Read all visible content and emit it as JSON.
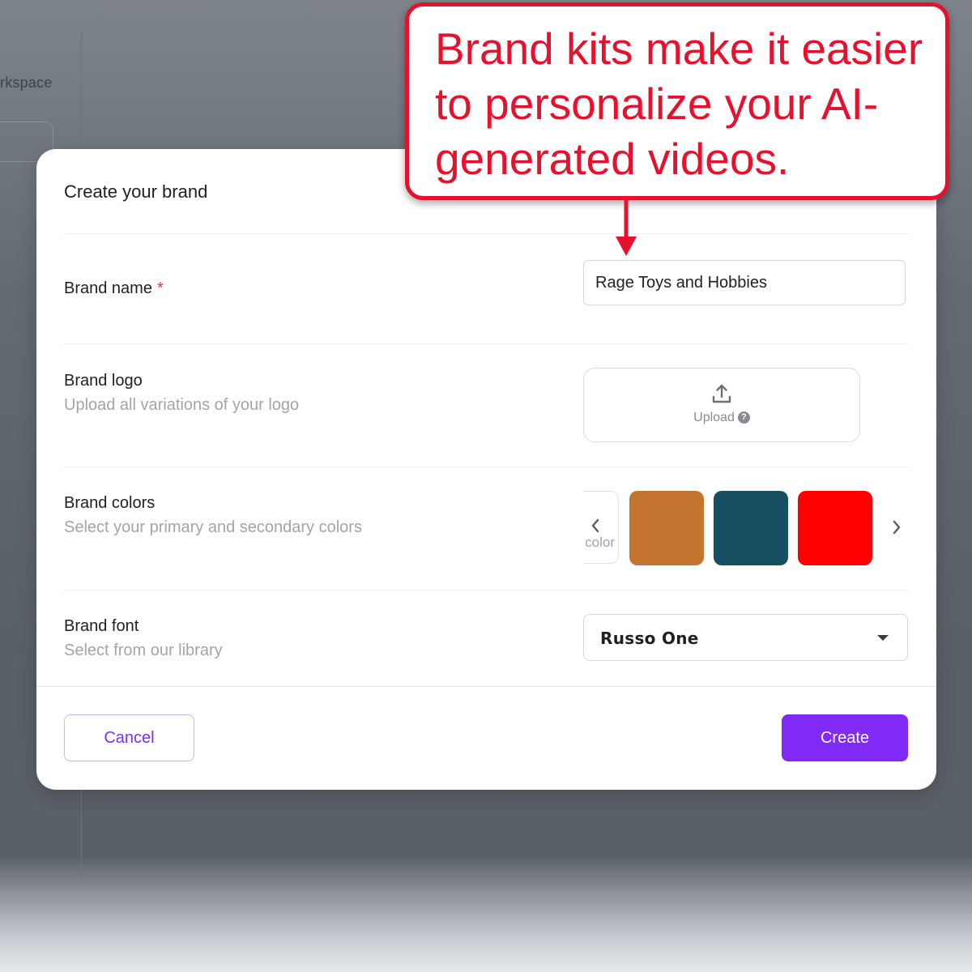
{
  "background": {
    "workspace_fragment": "rkspace"
  },
  "modal": {
    "title": "Create your brand",
    "brand_name": {
      "label": "Brand name",
      "required_mark": "*",
      "value": "Rage Toys and Hobbies"
    },
    "brand_logo": {
      "label": "Brand logo",
      "subtitle": "Upload all variations of your logo",
      "upload_label": "Upload",
      "help_glyph": "?",
      "upload_icon": "upload-icon"
    },
    "brand_colors": {
      "label": "Brand colors",
      "subtitle": "Select your primary and secondary colors",
      "add_tile_text": "color",
      "swatches": [
        "#c5752f",
        "#164f62",
        "#ff0000"
      ]
    },
    "brand_font": {
      "label": "Brand font",
      "subtitle": "Select from our library",
      "selected": "Russo One"
    },
    "buttons": {
      "cancel": "Cancel",
      "create": "Create"
    }
  },
  "callout": {
    "text": "Brand kits make it easier to personalize your AI-generated videos.",
    "color": "#e8112d"
  },
  "colors": {
    "accent": "#7f2af5",
    "required": "#e53945"
  }
}
